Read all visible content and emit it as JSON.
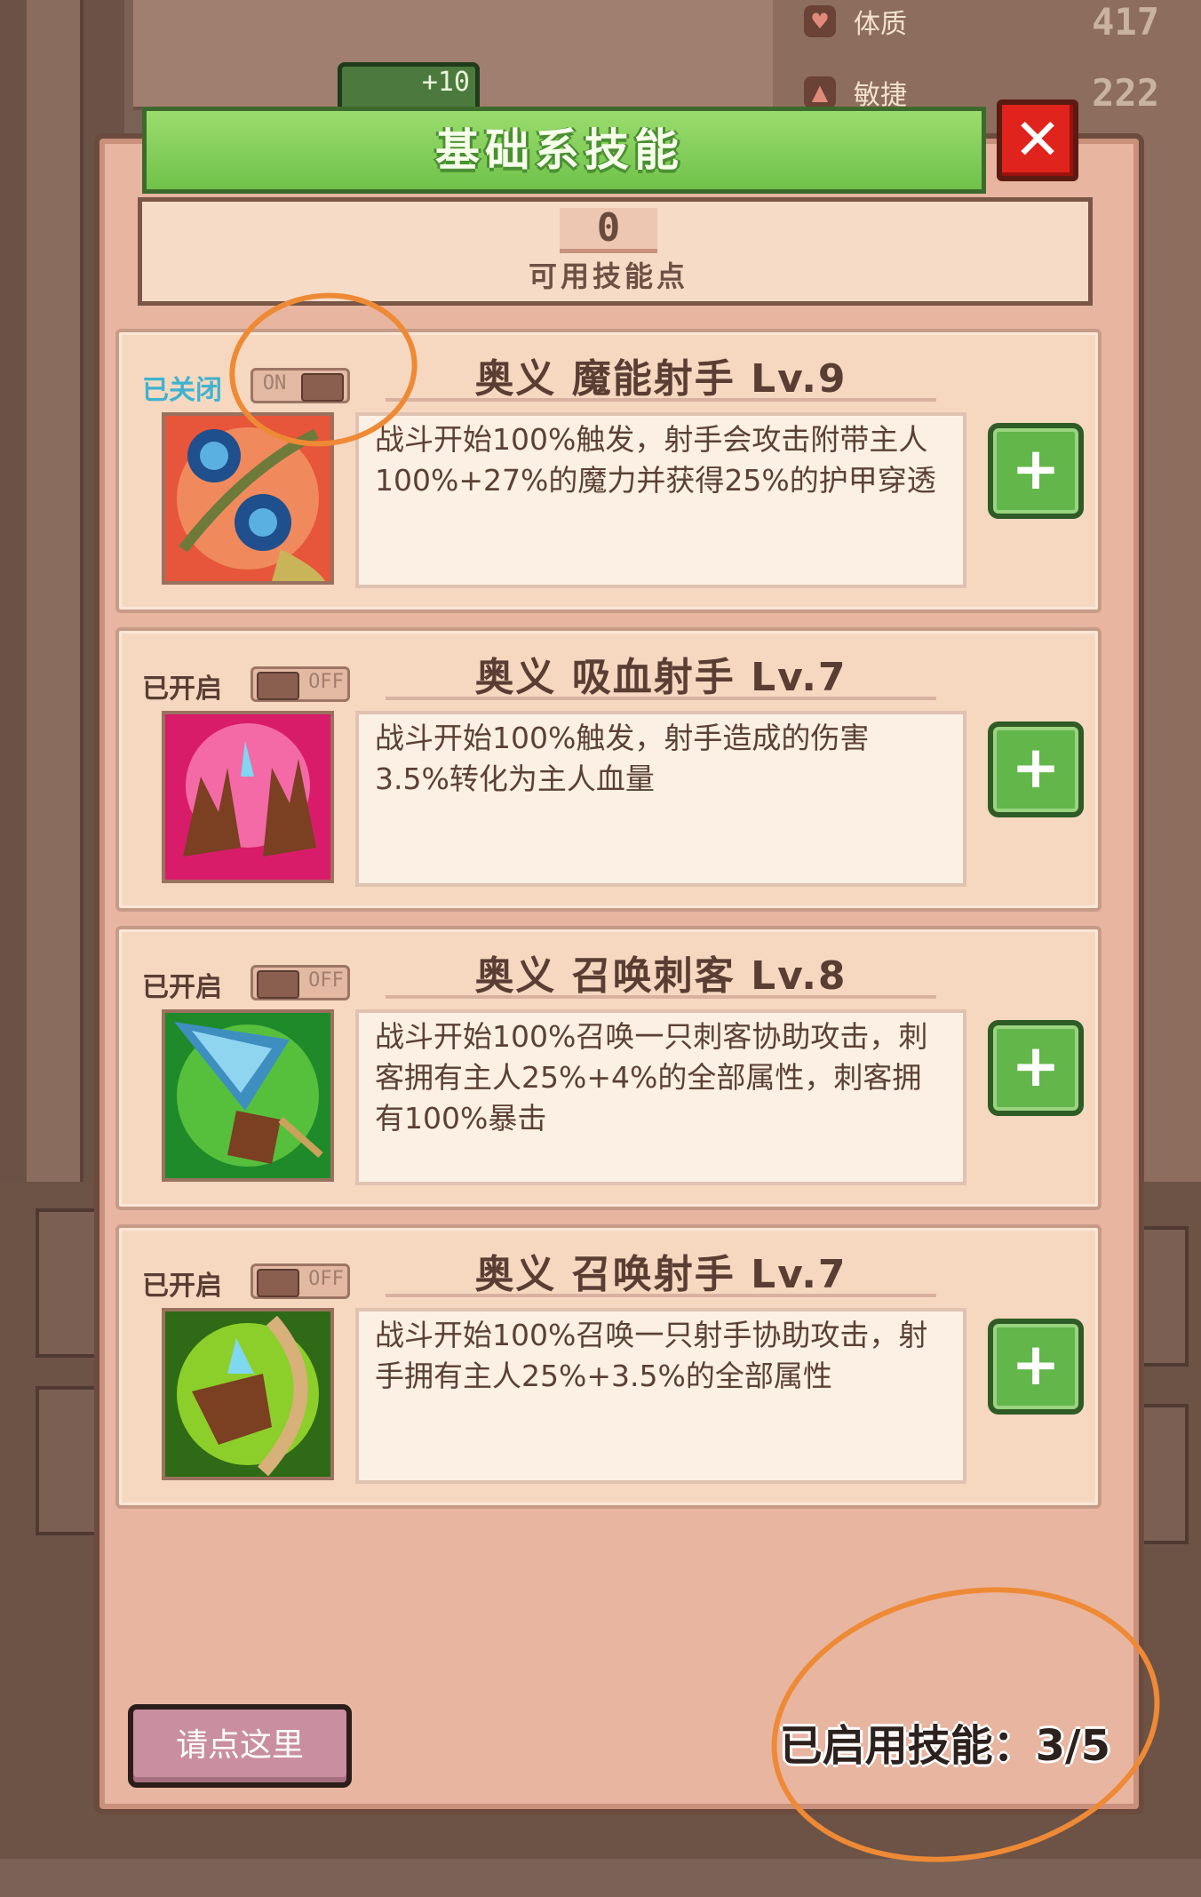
{
  "title": "基础系技能",
  "close_label": "✕",
  "skill_points": {
    "value": "0",
    "label": "可用技能点"
  },
  "background_stats": [
    {
      "name": "体质",
      "value": "417"
    },
    {
      "name": "敏捷",
      "value": "222"
    }
  ],
  "background_chip": "+10",
  "skills": [
    {
      "status": "已关闭",
      "toggle_label": "ON",
      "name": "奥义 魔能射手 Lv.9",
      "description": "战斗开始100%触发，射手会攻击附带主人100%+27%的魔力并获得25%的护甲穿透",
      "icon": "blue-flower-skill-icon"
    },
    {
      "status": "已开启",
      "toggle_label": "OFF",
      "name": "奥义 吸血射手 Lv.7",
      "description": "战斗开始100%触发，射手造成的伤害3.5%转化为主人血量",
      "icon": "vampire-hands-skill-icon"
    },
    {
      "status": "已开启",
      "toggle_label": "OFF",
      "name": "奥义 召唤刺客 Lv.8",
      "description": "战斗开始100%召唤一只刺客协助攻击，刺客拥有主人25%+4%的全部属性，刺客拥有100%暴击",
      "icon": "assassin-skill-icon"
    },
    {
      "status": "已开启",
      "toggle_label": "OFF",
      "name": "奥义 召唤射手 Lv.7",
      "description": "战斗开始100%召唤一只射手协助攻击，射手拥有主人25%+3.5%的全部属性",
      "icon": "archer-skill-icon"
    }
  ],
  "plus_label": "+",
  "footer": {
    "button_label": "请点这里",
    "enabled_label": "已启用技能：3/5"
  },
  "colors": {
    "header_green": "#6fc24a",
    "panel_pink": "#e8b5a0",
    "close_red": "#e0231c",
    "annotation_orange": "#ee8a35",
    "status_off_blue": "#3fb3ce"
  }
}
